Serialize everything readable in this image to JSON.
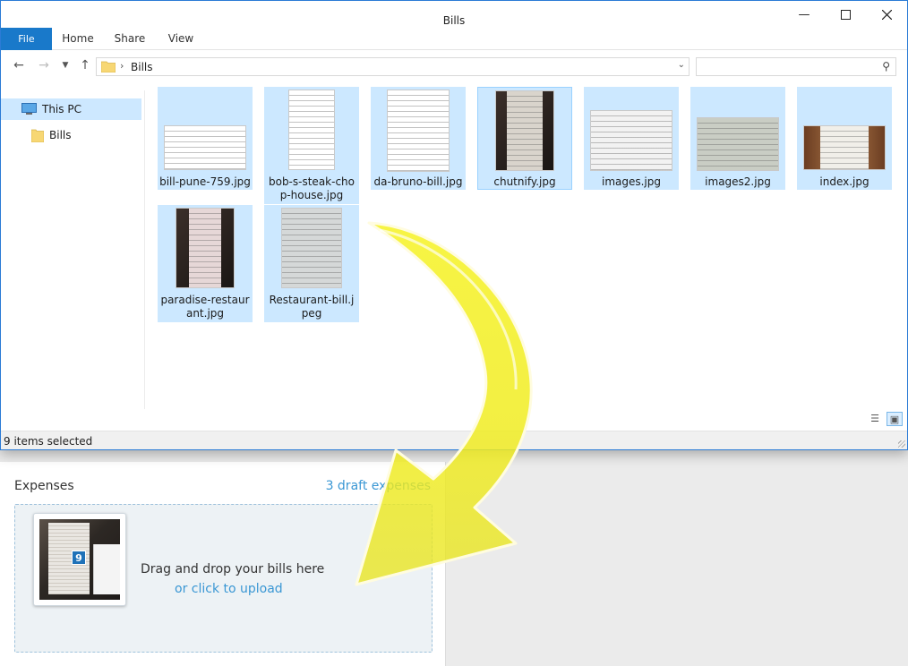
{
  "window": {
    "title": "Bills",
    "ribbon_tabs": [
      "File",
      "Home",
      "Share",
      "View"
    ],
    "address_path": "Bills",
    "search_placeholder": ""
  },
  "nav_pane": {
    "items": [
      {
        "label": "This PC",
        "icon": "computer-icon",
        "selected": true
      },
      {
        "label": "Bills",
        "icon": "folder-icon",
        "selected": false
      }
    ]
  },
  "files": [
    {
      "name": "bill-pune-759.jpg"
    },
    {
      "name": "bob-s-steak-chop-house.jpg"
    },
    {
      "name": "da-bruno-bill.jpg"
    },
    {
      "name": "chutnify.jpg"
    },
    {
      "name": "images.jpg"
    },
    {
      "name": "images2.jpg"
    },
    {
      "name": "index.jpg"
    },
    {
      "name": "paradise-restaurant.jpg"
    },
    {
      "name": "Restaurant-bill.jpeg"
    }
  ],
  "status": {
    "selection": "9 items selected"
  },
  "expenses": {
    "title": "Expenses",
    "draft_link": "3 draft expenses",
    "drop_text": "Drag and drop your bills here",
    "upload_link": "or click to upload",
    "drag_count": "9"
  },
  "colors": {
    "accent": "#1979ca",
    "selection": "#cce8ff",
    "link": "#3a97d4",
    "arrow": "#f3ef2e"
  }
}
